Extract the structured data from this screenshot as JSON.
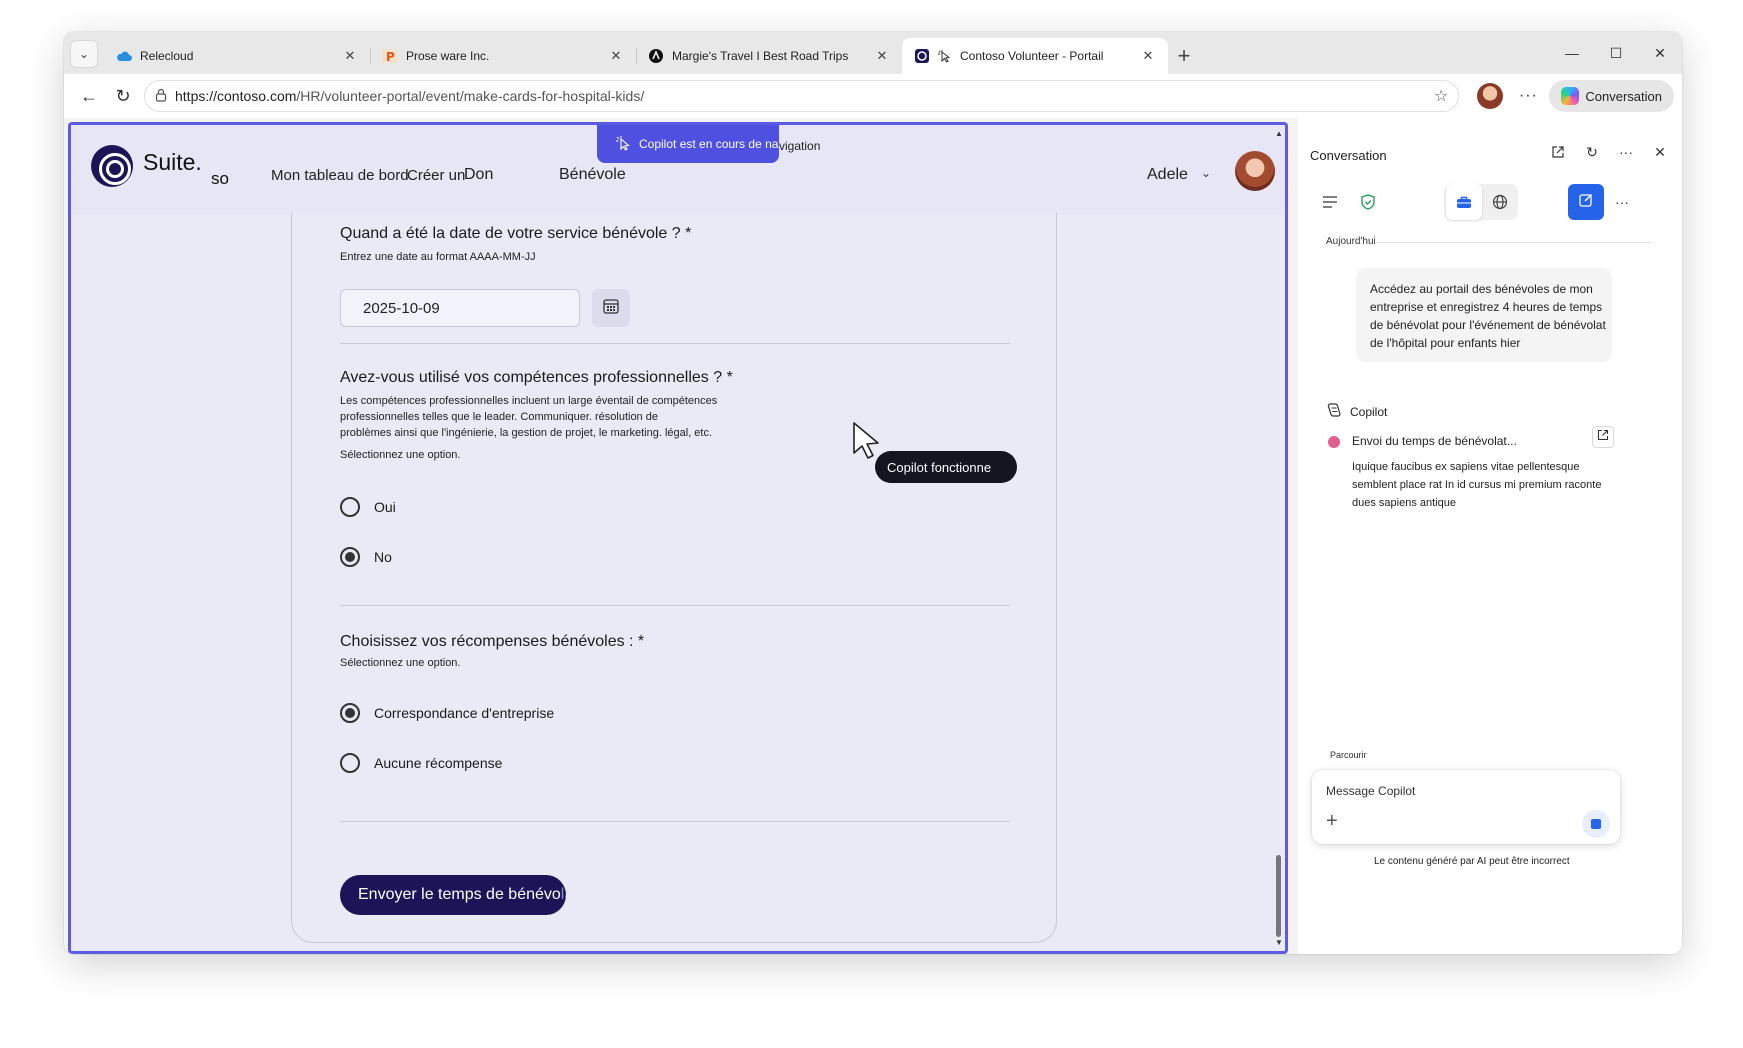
{
  "browser": {
    "tabs": [
      {
        "title": "Relecloud",
        "icon": "cloud-icon",
        "active": false
      },
      {
        "title": "Prose ware Inc.",
        "icon": "p-letter-icon",
        "active": false
      },
      {
        "title": "Margie's Travel I Best Road Trips",
        "icon": "travel-logo-icon",
        "active": false
      },
      {
        "title": "Contoso Volunteer - Portail",
        "icon": "contoso-ring-icon",
        "active": true
      }
    ],
    "url_host": "https://contoso.com",
    "url_path": "/HR/volunteer-portal/event/make-cards-for-hospital-kids/",
    "conversation_button": "Conversation"
  },
  "site": {
    "brand": "Suite.",
    "brand_sub": "so",
    "nav": [
      "Mon tableau de bord",
      "Créer un",
      "Don",
      "Bénévole"
    ],
    "user_name": "Adele",
    "copilot_banner": "Copilot est en cours de na",
    "copilot_banner_tail": "vigation"
  },
  "form": {
    "date_question": "Quand a été la date de votre service bénévole ? *",
    "date_hint": "Entrez une date au format AAAA-MM-JJ",
    "date_value": "2025-10-09",
    "skills_question": "Avez-vous utilisé vos compétences professionnelles ? *",
    "skills_hint_1": "Les compétences professionnelles incluent un large éventail de compétences",
    "skills_hint_2": "professionnelles telles que le leader. Communiquer. résolution de",
    "skills_hint_3": "problèmes ainsi que l'ingénierie, la gestion de projet, le marketing. légal, etc.",
    "select_option": "Sélectionnez une option.",
    "skills_options": [
      {
        "label": "Oui",
        "selected": false
      },
      {
        "label": "No",
        "selected": true
      }
    ],
    "rewards_question": "Choisissez vos récompenses bénévoles : *",
    "rewards_options": [
      {
        "label": "Correspondance d'entreprise",
        "selected": true
      },
      {
        "label": "Aucune récompense",
        "selected": false
      }
    ],
    "submit_label": "Envoyer le temps de bénévo",
    "submit_label_faded": "lat"
  },
  "agent": {
    "cursor_tooltip": "Copilot fonctionne"
  },
  "pane": {
    "title": "Conversation",
    "today": "Aujourd'hui",
    "user_message": "Accédez au portail des bénévoles de mon entreprise et enregistrez 4 heures de temps de bénévolat pour l'événement de bénévolat de l'hôpital pour enfants hier",
    "copilot_label": "Copilot",
    "status": "Envoi du temps de bénévolat...",
    "body": "Iquique faucibus ex sapiens vitae pellentesque semblent place rat In id cursus mi premium raconte dues sapiens antique",
    "parcours": "Parcourir",
    "composer_placeholder": "Message Copilot",
    "disclaimer": "Le contenu généré par AI peut être incorrect"
  },
  "colors": {
    "accent": "#5b5be6",
    "brand_dark": "#1c1457",
    "compose_blue": "#2563eb",
    "status_pink": "#e35f8e"
  }
}
